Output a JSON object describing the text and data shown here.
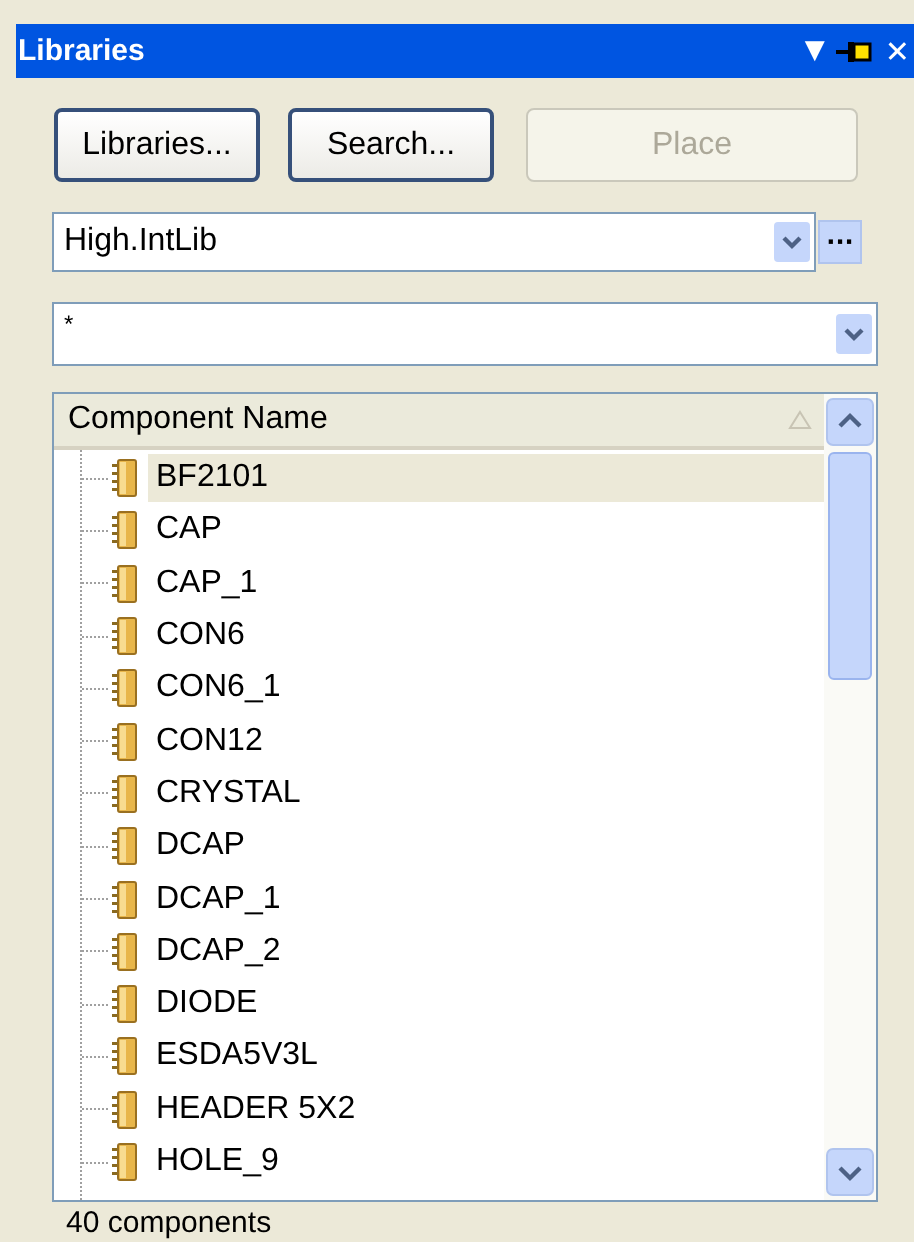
{
  "panel": {
    "title": "Libraries",
    "title_buttons": [
      "▼",
      "✕"
    ]
  },
  "buttons": [
    {
      "label": "Libraries...",
      "disabled": false
    },
    {
      "label": "Search...",
      "disabled": false
    },
    {
      "label": "Place",
      "disabled": true
    }
  ],
  "library_select": {
    "value": "High.IntLib",
    "more_label": "···"
  },
  "filter_select": {
    "value": "*"
  },
  "list": {
    "columns": [
      "Component Name"
    ],
    "rows": [
      {
        "name": "BF2101",
        "selected": true
      },
      {
        "name": "CAP",
        "selected": false
      },
      {
        "name": "CAP_1",
        "selected": false
      },
      {
        "name": "CON6",
        "selected": false
      },
      {
        "name": "CON6_1",
        "selected": false
      },
      {
        "name": "CON12",
        "selected": false
      },
      {
        "name": "CRYSTAL",
        "selected": false
      },
      {
        "name": "DCAP",
        "selected": false
      },
      {
        "name": "DCAP_1",
        "selected": false
      },
      {
        "name": "DCAP_2",
        "selected": false
      },
      {
        "name": "DIODE",
        "selected": false
      },
      {
        "name": "ESDA5V3L",
        "selected": false
      },
      {
        "name": "HEADER 5X2",
        "selected": false
      },
      {
        "name": "HOLE_9",
        "selected": false
      }
    ]
  },
  "status_bar": "40 components"
}
